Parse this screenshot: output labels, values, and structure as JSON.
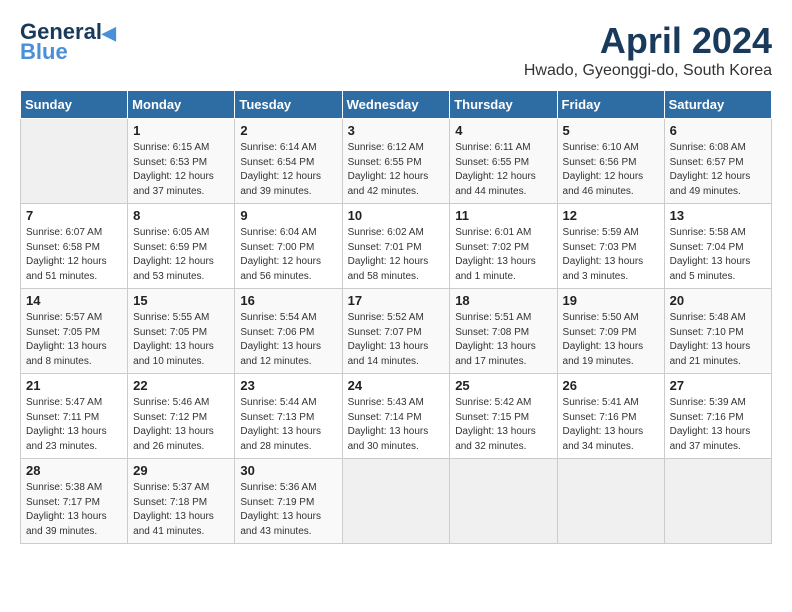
{
  "header": {
    "logo_general": "General",
    "logo_blue": "Blue",
    "month_title": "April 2024",
    "location": "Hwado, Gyeonggi-do, South Korea"
  },
  "weekdays": [
    "Sunday",
    "Monday",
    "Tuesday",
    "Wednesday",
    "Thursday",
    "Friday",
    "Saturday"
  ],
  "weeks": [
    [
      {
        "day": "",
        "info": ""
      },
      {
        "day": "1",
        "info": "Sunrise: 6:15 AM\nSunset: 6:53 PM\nDaylight: 12 hours\nand 37 minutes."
      },
      {
        "day": "2",
        "info": "Sunrise: 6:14 AM\nSunset: 6:54 PM\nDaylight: 12 hours\nand 39 minutes."
      },
      {
        "day": "3",
        "info": "Sunrise: 6:12 AM\nSunset: 6:55 PM\nDaylight: 12 hours\nand 42 minutes."
      },
      {
        "day": "4",
        "info": "Sunrise: 6:11 AM\nSunset: 6:55 PM\nDaylight: 12 hours\nand 44 minutes."
      },
      {
        "day": "5",
        "info": "Sunrise: 6:10 AM\nSunset: 6:56 PM\nDaylight: 12 hours\nand 46 minutes."
      },
      {
        "day": "6",
        "info": "Sunrise: 6:08 AM\nSunset: 6:57 PM\nDaylight: 12 hours\nand 49 minutes."
      }
    ],
    [
      {
        "day": "7",
        "info": "Sunrise: 6:07 AM\nSunset: 6:58 PM\nDaylight: 12 hours\nand 51 minutes."
      },
      {
        "day": "8",
        "info": "Sunrise: 6:05 AM\nSunset: 6:59 PM\nDaylight: 12 hours\nand 53 minutes."
      },
      {
        "day": "9",
        "info": "Sunrise: 6:04 AM\nSunset: 7:00 PM\nDaylight: 12 hours\nand 56 minutes."
      },
      {
        "day": "10",
        "info": "Sunrise: 6:02 AM\nSunset: 7:01 PM\nDaylight: 12 hours\nand 58 minutes."
      },
      {
        "day": "11",
        "info": "Sunrise: 6:01 AM\nSunset: 7:02 PM\nDaylight: 13 hours\nand 1 minute."
      },
      {
        "day": "12",
        "info": "Sunrise: 5:59 AM\nSunset: 7:03 PM\nDaylight: 13 hours\nand 3 minutes."
      },
      {
        "day": "13",
        "info": "Sunrise: 5:58 AM\nSunset: 7:04 PM\nDaylight: 13 hours\nand 5 minutes."
      }
    ],
    [
      {
        "day": "14",
        "info": "Sunrise: 5:57 AM\nSunset: 7:05 PM\nDaylight: 13 hours\nand 8 minutes."
      },
      {
        "day": "15",
        "info": "Sunrise: 5:55 AM\nSunset: 7:05 PM\nDaylight: 13 hours\nand 10 minutes."
      },
      {
        "day": "16",
        "info": "Sunrise: 5:54 AM\nSunset: 7:06 PM\nDaylight: 13 hours\nand 12 minutes."
      },
      {
        "day": "17",
        "info": "Sunrise: 5:52 AM\nSunset: 7:07 PM\nDaylight: 13 hours\nand 14 minutes."
      },
      {
        "day": "18",
        "info": "Sunrise: 5:51 AM\nSunset: 7:08 PM\nDaylight: 13 hours\nand 17 minutes."
      },
      {
        "day": "19",
        "info": "Sunrise: 5:50 AM\nSunset: 7:09 PM\nDaylight: 13 hours\nand 19 minutes."
      },
      {
        "day": "20",
        "info": "Sunrise: 5:48 AM\nSunset: 7:10 PM\nDaylight: 13 hours\nand 21 minutes."
      }
    ],
    [
      {
        "day": "21",
        "info": "Sunrise: 5:47 AM\nSunset: 7:11 PM\nDaylight: 13 hours\nand 23 minutes."
      },
      {
        "day": "22",
        "info": "Sunrise: 5:46 AM\nSunset: 7:12 PM\nDaylight: 13 hours\nand 26 minutes."
      },
      {
        "day": "23",
        "info": "Sunrise: 5:44 AM\nSunset: 7:13 PM\nDaylight: 13 hours\nand 28 minutes."
      },
      {
        "day": "24",
        "info": "Sunrise: 5:43 AM\nSunset: 7:14 PM\nDaylight: 13 hours\nand 30 minutes."
      },
      {
        "day": "25",
        "info": "Sunrise: 5:42 AM\nSunset: 7:15 PM\nDaylight: 13 hours\nand 32 minutes."
      },
      {
        "day": "26",
        "info": "Sunrise: 5:41 AM\nSunset: 7:16 PM\nDaylight: 13 hours\nand 34 minutes."
      },
      {
        "day": "27",
        "info": "Sunrise: 5:39 AM\nSunset: 7:16 PM\nDaylight: 13 hours\nand 37 minutes."
      }
    ],
    [
      {
        "day": "28",
        "info": "Sunrise: 5:38 AM\nSunset: 7:17 PM\nDaylight: 13 hours\nand 39 minutes."
      },
      {
        "day": "29",
        "info": "Sunrise: 5:37 AM\nSunset: 7:18 PM\nDaylight: 13 hours\nand 41 minutes."
      },
      {
        "day": "30",
        "info": "Sunrise: 5:36 AM\nSunset: 7:19 PM\nDaylight: 13 hours\nand 43 minutes."
      },
      {
        "day": "",
        "info": ""
      },
      {
        "day": "",
        "info": ""
      },
      {
        "day": "",
        "info": ""
      },
      {
        "day": "",
        "info": ""
      }
    ]
  ]
}
